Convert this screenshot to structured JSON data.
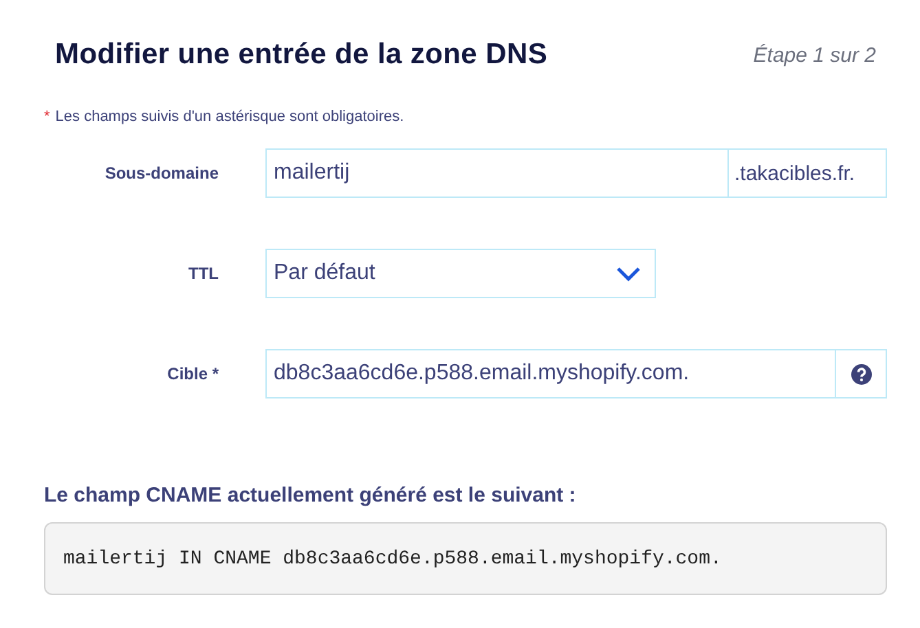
{
  "title": "Modifier une entrée de la zone DNS",
  "step": "Étape 1 sur 2",
  "required_note": {
    "asterisk": "*",
    "text": "Les champs suivis d'un astérisque sont obligatoires."
  },
  "fields": [
    {
      "kind": "text",
      "label": "Sous-domaine",
      "value": "mailertij",
      "suffix": ".takacibles.fr."
    },
    {
      "kind": "select",
      "label": "TTL",
      "value": "Par défaut"
    },
    {
      "kind": "help",
      "label": "Cible *",
      "value": "db8c3aa6cd6e.p588.email.myshopify.com."
    }
  ],
  "generated": {
    "heading": "Le champ CNAME actuellement généré est le suivant :",
    "code": "mailertij IN CNAME db8c3aa6cd6e.p588.email.myshopify.com."
  }
}
